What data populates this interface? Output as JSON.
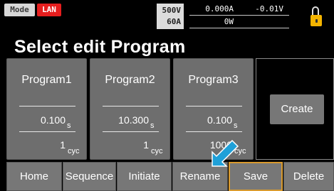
{
  "status": {
    "mode": "Mode",
    "lan": "LAN",
    "voltage_range": "500V",
    "current_range": "60A",
    "current": "0.000A",
    "voltage": "-0.01V",
    "power": "0W"
  },
  "title": "Select edit Program",
  "programs": [
    {
      "name": "Program1",
      "time": "0.100",
      "time_unit": "s",
      "cycles": "1",
      "cycles_unit": "cyc"
    },
    {
      "name": "Program2",
      "time": "10.300",
      "time_unit": "s",
      "cycles": "1",
      "cycles_unit": "cyc"
    },
    {
      "name": "Program3",
      "time": "0.100",
      "time_unit": "s",
      "cycles": "1000",
      "cycles_unit": "cyc"
    }
  ],
  "create_label": "Create",
  "buttons": [
    "Home",
    "Sequence",
    "Initiate",
    "Rename",
    "Save",
    "Delete"
  ],
  "colors": {
    "accent_lock": "#f4b400",
    "lan_badge": "#e61e1e",
    "save_border": "#d99a2e",
    "arrow": "#1fa0d8"
  }
}
